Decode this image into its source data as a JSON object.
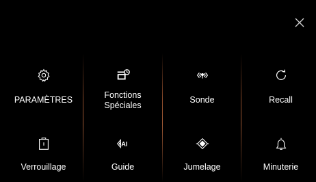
{
  "close": {
    "icon": "close-icon"
  },
  "menu": {
    "items": [
      {
        "label": "PARAMÈTRES",
        "icon": "gear-icon"
      },
      {
        "label": "Fonctions\nSpéciales",
        "icon": "special-functions-icon"
      },
      {
        "label": "Sonde",
        "icon": "probe-icon"
      },
      {
        "label": "Recall",
        "icon": "recall-icon"
      },
      {
        "label": "Verrouillage",
        "icon": "lock-icon"
      },
      {
        "label": "Guide",
        "icon": "ai-guide-icon",
        "icon_text": "AI"
      },
      {
        "label": "Jumelage",
        "icon": "pairing-icon"
      },
      {
        "label": "Minuterie",
        "icon": "bell-icon"
      }
    ]
  },
  "colors": {
    "background": "#000000",
    "text": "#ffffff",
    "divider": "#a05a35"
  }
}
